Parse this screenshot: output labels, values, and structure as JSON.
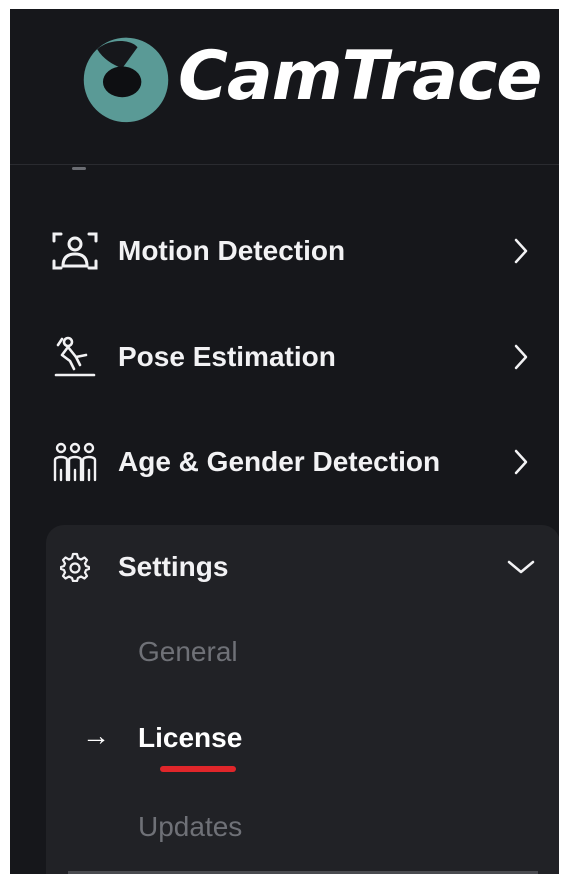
{
  "brand": {
    "name": "CamTrace",
    "accent_color": "#5a9a96"
  },
  "nav": {
    "items": [
      {
        "label": "Motion Detection",
        "icon": "person-scan-icon"
      },
      {
        "label": "Pose Estimation",
        "icon": "pose-person-icon"
      },
      {
        "label": "Age & Gender Detection",
        "icon": "group-people-icon"
      }
    ],
    "settings": {
      "label": "Settings",
      "icon": "gear-icon",
      "expanded": true,
      "subitems": [
        {
          "label": "General",
          "active": false
        },
        {
          "label": "License",
          "active": true
        },
        {
          "label": "Updates",
          "active": false
        }
      ],
      "active_indicator": "→",
      "active_underline_color": "#e0262a"
    }
  }
}
